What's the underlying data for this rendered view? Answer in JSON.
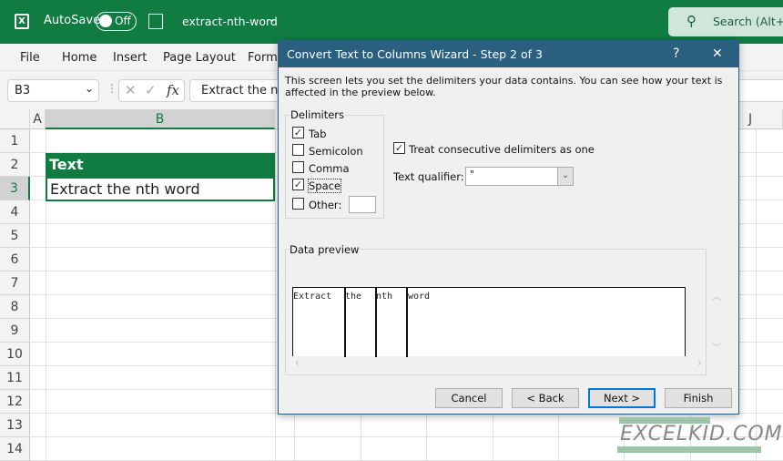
{
  "app": {
    "autosave_label": "AutoSave",
    "autosave_state": "Off",
    "filename": "extract-nth-word",
    "search_placeholder": "Search (Alt+Q)",
    "brand_color": "#107c41"
  },
  "ribbon": {
    "tabs": [
      "File",
      "Home",
      "Insert",
      "Page Layout",
      "Formu"
    ]
  },
  "formula_bar": {
    "name_box": "B3",
    "fx": "fx",
    "content": "Extract the nth word"
  },
  "sheet": {
    "columns": [
      "A",
      "B",
      "J"
    ],
    "rows": [
      "1",
      "2",
      "3",
      "4",
      "5",
      "6",
      "7",
      "8",
      "9",
      "10",
      "11",
      "12",
      "13",
      "14"
    ],
    "B2": "Text",
    "B3": "Extract the nth word"
  },
  "dialog": {
    "title": "Convert Text to Columns Wizard - Step 2 of 3",
    "help": "?",
    "close": "✕",
    "description": "This screen lets you set the delimiters your data contains.  You can see how your text is affected in the preview below.",
    "delimiters_label": "Delimiters",
    "delimiters": [
      {
        "label": "Tab",
        "checked": true
      },
      {
        "label": "Semicolon",
        "checked": false
      },
      {
        "label": "Comma",
        "checked": false
      },
      {
        "label": "Space",
        "checked": true
      },
      {
        "label": "Other:",
        "checked": false
      }
    ],
    "other_value": "",
    "consecutive_label": "Treat consecutive delimiters as one",
    "consecutive_checked": true,
    "qualifier_label": "Text qualifier:",
    "qualifier_value": "\"",
    "preview_label": "Data preview",
    "preview_columns": [
      "Extract",
      "the",
      "nth",
      "word"
    ],
    "buttons": {
      "cancel": "Cancel",
      "back": "< Back",
      "next": "Next >",
      "finish": "Finish"
    }
  },
  "watermark": "EXCELKID.COM"
}
